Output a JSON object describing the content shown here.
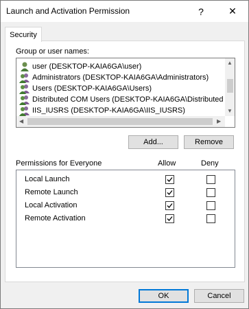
{
  "window": {
    "title": "Launch and Activation Permission",
    "help_glyph": "?",
    "close_glyph": "✕"
  },
  "tabs": [
    {
      "label": "Security"
    }
  ],
  "group_list": {
    "label": "Group or user names:",
    "items": [
      {
        "name": "user (DESKTOP-KAIA6GA\\user)",
        "icon": "user-icon"
      },
      {
        "name": "Administrators (DESKTOP-KAIA6GA\\Administrators)",
        "icon": "group-icon"
      },
      {
        "name": "Users (DESKTOP-KAIA6GA\\Users)",
        "icon": "group-icon"
      },
      {
        "name": "Distributed COM Users (DESKTOP-KAIA6GA\\Distributed C",
        "icon": "group-icon"
      },
      {
        "name": "IIS_IUSRS (DESKTOP-KAIA6GA\\IIS_IUSRS)",
        "icon": "group-icon"
      }
    ]
  },
  "buttons": {
    "add": "Add...",
    "remove": "Remove",
    "ok": "OK",
    "cancel": "Cancel"
  },
  "permissions": {
    "label": "Permissions for Everyone",
    "allow_header": "Allow",
    "deny_header": "Deny",
    "rows": [
      {
        "name": "Local Launch",
        "allow": true,
        "deny": false
      },
      {
        "name": "Remote Launch",
        "allow": true,
        "deny": false
      },
      {
        "name": "Local Activation",
        "allow": true,
        "deny": false
      },
      {
        "name": "Remote Activation",
        "allow": true,
        "deny": false
      }
    ]
  }
}
